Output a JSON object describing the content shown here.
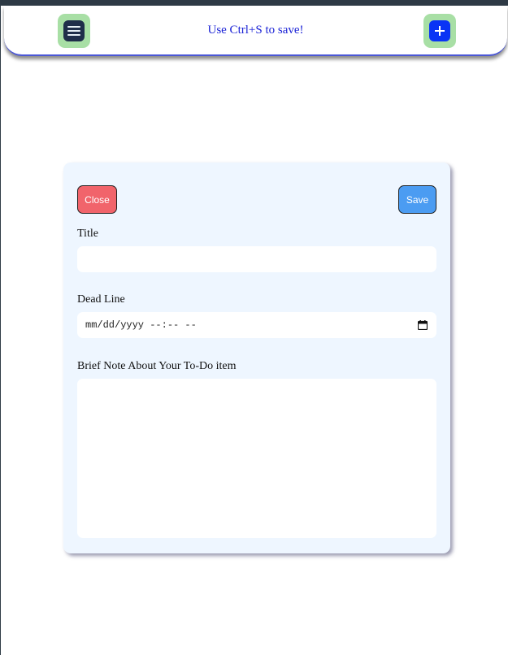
{
  "header": {
    "menu_icon": "hamburger-menu-icon",
    "hint": "Use Ctrl+S to save!",
    "add_icon": "plus-icon",
    "colors": {
      "button_bg": "#a8dfa5",
      "menu_inner": "#1f2d4a",
      "add_inner": "#0a34f5",
      "hint_text": "#1a22d6"
    }
  },
  "form": {
    "close_label": "Close",
    "save_label": "Save",
    "title_label": "Title",
    "title_value": "",
    "deadline_label": "Dead Line",
    "deadline_value": "mm/dd/yyyy --:-- --",
    "note_label": "Brief Note About Your To-Do item",
    "note_value": "",
    "colors": {
      "card_bg": "#eef6ff",
      "close_bg": "#f1646b",
      "save_bg": "#4b9cf2"
    }
  }
}
